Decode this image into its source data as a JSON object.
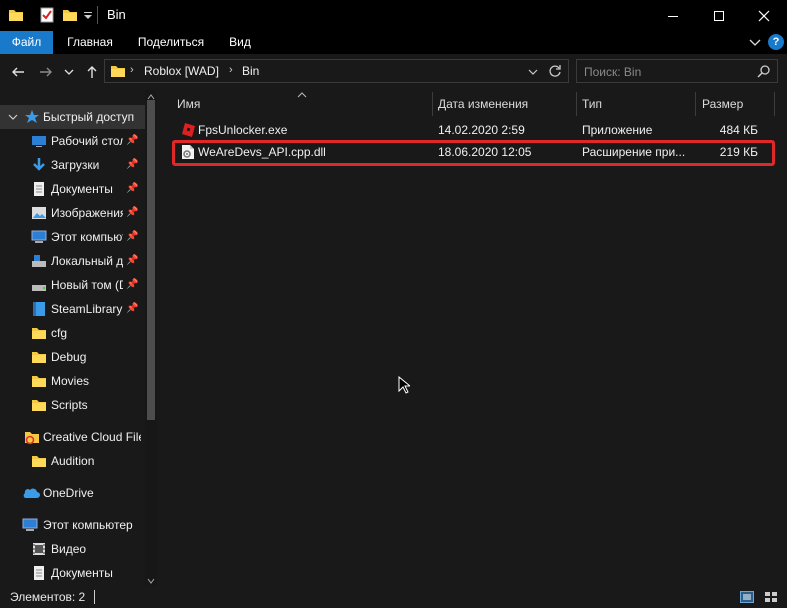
{
  "titlebar": {
    "title": "Bin",
    "buttons": [
      "minimize",
      "maximize",
      "close"
    ]
  },
  "ribbon": {
    "tabs": [
      "Файл",
      "Главная",
      "Поделиться",
      "Вид"
    ]
  },
  "address": {
    "crumbs": [
      "Roblox [WAD]",
      "Bin"
    ],
    "search_placeholder": "Поиск: Bin"
  },
  "nav": {
    "items": [
      {
        "label": "Быстрый доступ",
        "icon": "star-icon",
        "pinned": false
      },
      {
        "label": "Рабочий стол",
        "icon": "desktop-icon",
        "pinned": true
      },
      {
        "label": "Загрузки",
        "icon": "download-icon",
        "pinned": true
      },
      {
        "label": "Документы",
        "icon": "document-icon",
        "pinned": true
      },
      {
        "label": "Изображения",
        "icon": "pictures-icon",
        "pinned": true
      },
      {
        "label": "Этот компьютер",
        "icon": "computer-icon",
        "pinned": true
      },
      {
        "label": "Локальный диск",
        "icon": "drive-icon",
        "pinned": true
      },
      {
        "label": "Новый том (D:)",
        "icon": "drive-icon",
        "pinned": true
      },
      {
        "label": "SteamLibrary",
        "icon": "folder-icon",
        "pinned": true
      },
      {
        "label": "cfg",
        "icon": "folder-icon",
        "pinned": false
      },
      {
        "label": "Debug",
        "icon": "folder-icon",
        "pinned": false
      },
      {
        "label": "Movies",
        "icon": "folder-icon",
        "pinned": false
      },
      {
        "label": "Scripts",
        "icon": "folder-icon",
        "pinned": false
      },
      {
        "label": "Creative Cloud Files",
        "icon": "creative-cloud-icon",
        "pinned": false
      },
      {
        "label": "Audition",
        "icon": "folder-icon",
        "pinned": false
      },
      {
        "label": "OneDrive",
        "icon": "onedrive-icon",
        "pinned": false
      },
      {
        "label": "Этот компьютер",
        "icon": "computer-icon",
        "pinned": false
      },
      {
        "label": "Видео",
        "icon": "video-icon",
        "pinned": false
      },
      {
        "label": "Документы",
        "icon": "document-icon",
        "pinned": false
      }
    ]
  },
  "columns": {
    "name": "Имя",
    "date": "Дата изменения",
    "type": "Тип",
    "size": "Размер"
  },
  "files": [
    {
      "name": "FpsUnlocker.exe",
      "date": "14.02.2020 2:59",
      "type": "Приложение",
      "size": "484 КБ",
      "icon": "roblox-app-icon"
    },
    {
      "name": "WeAreDevs_API.cpp.dll",
      "date": "18.06.2020 12:05",
      "type": "Расширение при...",
      "size": "219 КБ",
      "icon": "dll-file-icon"
    }
  ],
  "status": {
    "text": "Элементов: 2"
  }
}
